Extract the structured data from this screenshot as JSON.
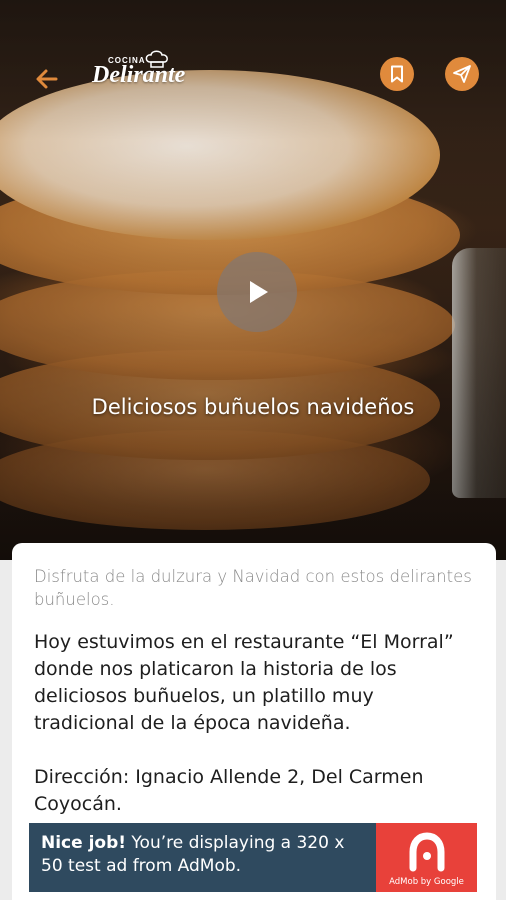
{
  "header": {
    "logo_small": "COCINA",
    "logo_main": "Delirante",
    "back_icon": "back-arrow-icon",
    "bookmark_icon": "bookmark-icon",
    "share_icon": "send-icon",
    "accent_color": "#e08a3c"
  },
  "hero": {
    "title": "Deliciosos buñuelos navideños",
    "play_icon": "play-icon"
  },
  "article": {
    "subtitle": "Disfruta de la dulzura y Navidad con estos delirantes buñuelos.",
    "paragraphs": [
      "Hoy estuvimos en el restaurante “El Morral” donde nos platicaron la historia de los deliciosos buñuelos, un platillo muy tradicional de la época navideña.",
      "Dirección: Ignacio Allende 2, Del Carmen Coyocán."
    ]
  },
  "ad": {
    "headline": "Nice job!",
    "message": " You’re displaying a 320 x 50 test ad from AdMob.",
    "brand": "AdMob by Google",
    "background": "#2f4a5f",
    "brand_color": "#e8413a"
  }
}
